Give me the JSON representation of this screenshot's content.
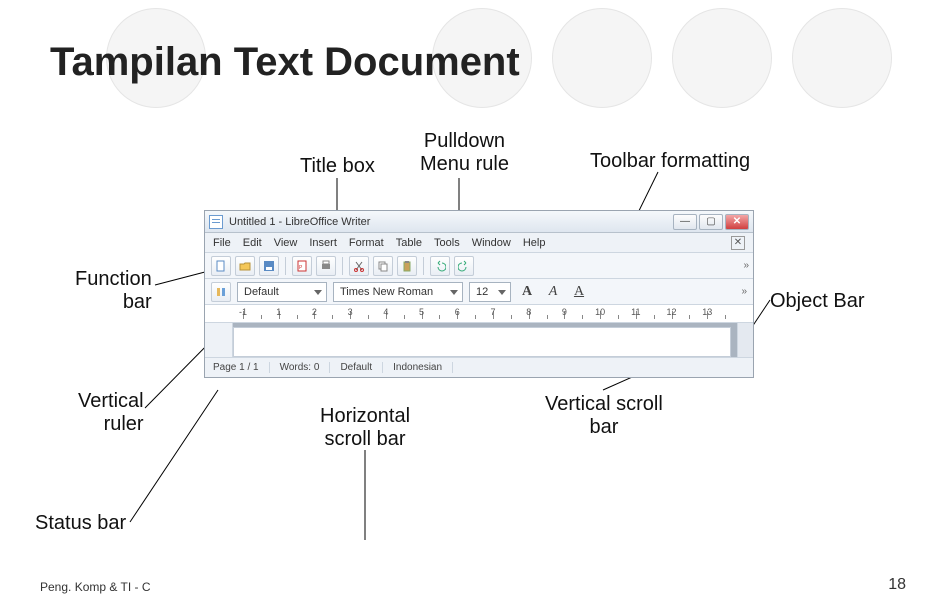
{
  "slide": {
    "title": "Tampilan Text Document",
    "footer_left": "Peng. Komp & TI - C",
    "footer_right": "18"
  },
  "labels": {
    "title_box": "Title box",
    "pulldown": "Pulldown\nMenu rule",
    "toolbar_formatting": "Toolbar formatting",
    "function_bar": "Function\nbar",
    "object_bar": "Object Bar",
    "vertical_ruler": "Vertical\nruler",
    "horizontal_scroll": "Horizontal\nscroll bar",
    "vertical_scroll": "Vertical scroll\nbar",
    "status_bar": "Status bar"
  },
  "app": {
    "title": "Untitled 1 - LibreOffice Writer",
    "menu": [
      "File",
      "Edit",
      "View",
      "Insert",
      "Format",
      "Table",
      "Tools",
      "Window",
      "Help"
    ],
    "format": {
      "style": "Default",
      "font": "Times New Roman",
      "size": "12"
    },
    "status": {
      "page": "Page 1 / 1",
      "words": "Words: 0",
      "default": "Default",
      "lang": "Indonesian"
    },
    "ruler_marks": [
      -1,
      1,
      2,
      3,
      4,
      5,
      6,
      7,
      8,
      9,
      10,
      11,
      12,
      13
    ]
  }
}
